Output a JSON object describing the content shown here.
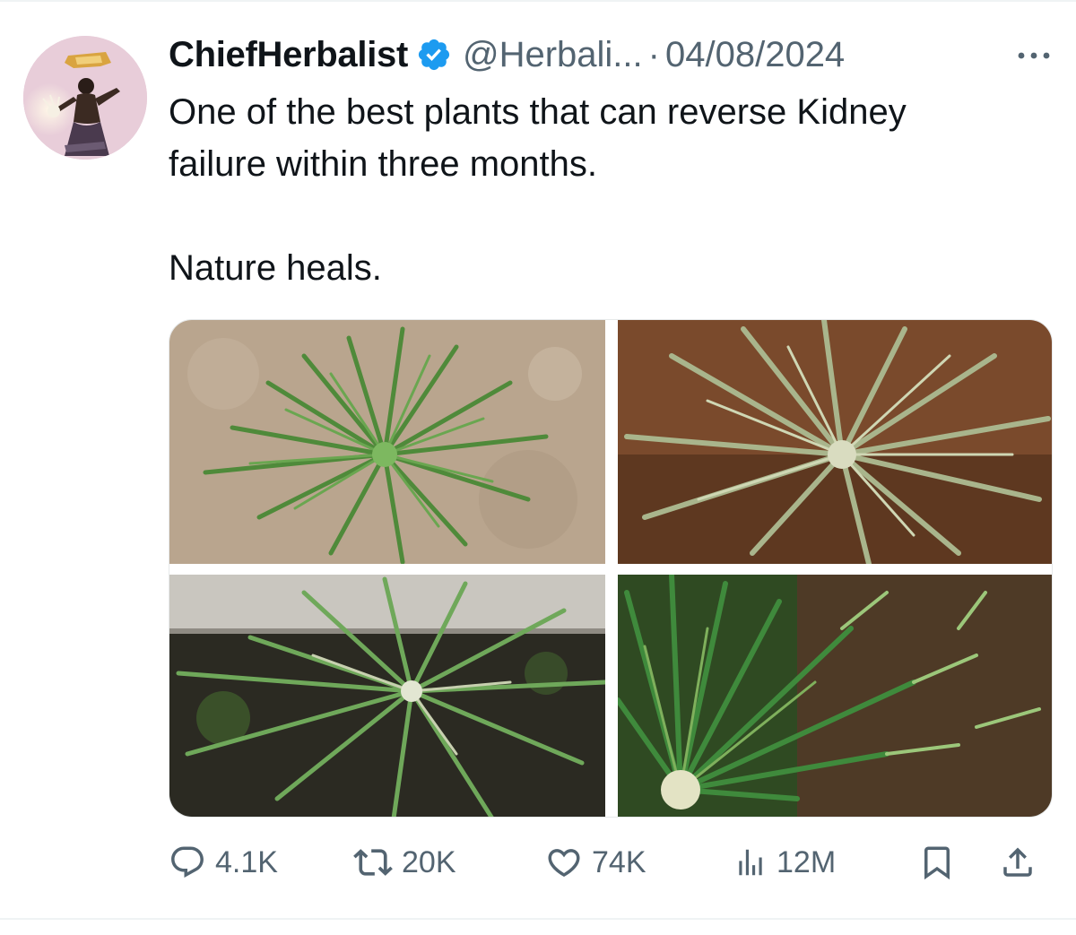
{
  "tweet": {
    "display_name": "ChiefHerbalist",
    "verified": true,
    "handle": "@Herbali...",
    "separator": "·",
    "date": "04/08/2024",
    "text_line1": "One of the best plants that can reverse Kidney",
    "text_line2": "failure within three months.",
    "text_line3": "Nature heals.",
    "media": [
      {
        "icon": "grass-plant-photo-dry-soil"
      },
      {
        "icon": "grass-plant-photo-red-soil"
      },
      {
        "icon": "grass-plant-photo-mossy-wall"
      },
      {
        "icon": "grass-plant-photo-seed-heads"
      }
    ]
  },
  "actions": {
    "replies": "4.1K",
    "retweets": "20K",
    "likes": "74K",
    "views": "12M"
  },
  "colors": {
    "text": "#0f1419",
    "secondary": "#536471",
    "verified_blue": "#1d9bf0",
    "divider": "#eff3f4"
  }
}
